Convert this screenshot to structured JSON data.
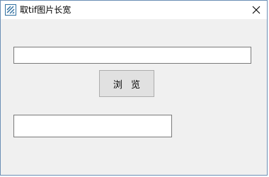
{
  "window": {
    "title": "取tif图片长宽",
    "app_icon": "winform-app-icon",
    "close_icon": "close-icon"
  },
  "form": {
    "path_input": {
      "value": "",
      "placeholder": ""
    },
    "browse_button_label": "浏 览",
    "result_input": {
      "value": "",
      "placeholder": ""
    }
  },
  "colors": {
    "title_bar": "#ffffff",
    "client_area": "#f0f0f0",
    "button_face": "#e1e1e1",
    "window_border": "#6b8fb5"
  }
}
